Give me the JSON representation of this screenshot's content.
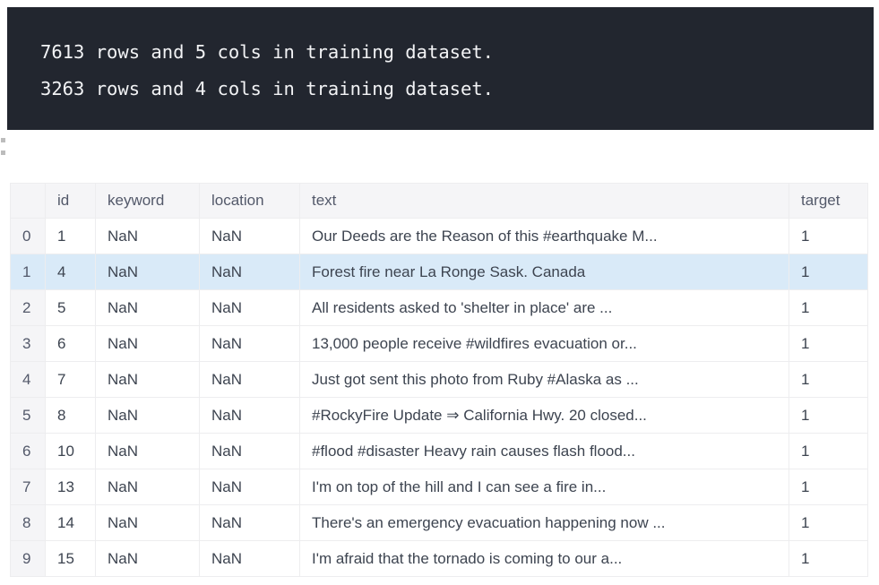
{
  "output": {
    "lines": [
      "7613 rows and 5 cols in training dataset.",
      "3263 rows and 4 cols in training dataset."
    ],
    "background_color": "#22262f",
    "text_color": "#f2f3f5"
  },
  "table": {
    "index_header": "",
    "columns": [
      "id",
      "keyword",
      "location",
      "text",
      "target"
    ],
    "highlight_color": "#d9eaf8",
    "header_background": "#f5f5f7",
    "highlighted_row_index": 1,
    "rows": [
      {
        "index": "0",
        "id": "1",
        "keyword": "NaN",
        "location": "NaN",
        "text": "Our Deeds are the Reason of this #earthquake M...",
        "target": "1"
      },
      {
        "index": "1",
        "id": "4",
        "keyword": "NaN",
        "location": "NaN",
        "text": "Forest fire near La Ronge Sask. Canada",
        "target": "1"
      },
      {
        "index": "2",
        "id": "5",
        "keyword": "NaN",
        "location": "NaN",
        "text": "All residents asked to 'shelter in place' are ...",
        "target": "1"
      },
      {
        "index": "3",
        "id": "6",
        "keyword": "NaN",
        "location": "NaN",
        "text": "13,000 people receive #wildfires evacuation or...",
        "target": "1"
      },
      {
        "index": "4",
        "id": "7",
        "keyword": "NaN",
        "location": "NaN",
        "text": "Just got sent this photo from Ruby #Alaska as ...",
        "target": "1"
      },
      {
        "index": "5",
        "id": "8",
        "keyword": "NaN",
        "location": "NaN",
        "text": "#RockyFire Update ⇒ California Hwy. 20 closed...",
        "target": "1"
      },
      {
        "index": "6",
        "id": "10",
        "keyword": "NaN",
        "location": "NaN",
        "text": "#flood #disaster Heavy rain causes flash flood...",
        "target": "1"
      },
      {
        "index": "7",
        "id": "13",
        "keyword": "NaN",
        "location": "NaN",
        "text": "I'm on top of the hill and I can see a fire in...",
        "target": "1"
      },
      {
        "index": "8",
        "id": "14",
        "keyword": "NaN",
        "location": "NaN",
        "text": "There's an emergency evacuation happening now ...",
        "target": "1"
      },
      {
        "index": "9",
        "id": "15",
        "keyword": "NaN",
        "location": "NaN",
        "text": "I'm afraid that the tornado is coming to our a...",
        "target": "1"
      }
    ]
  }
}
